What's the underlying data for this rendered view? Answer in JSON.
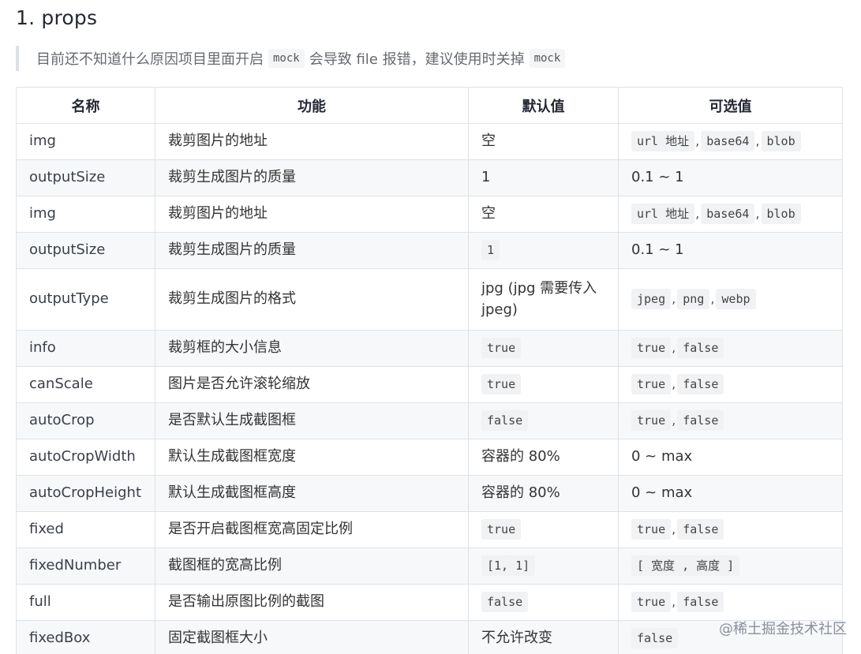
{
  "heading": "1. props",
  "note": {
    "before": "目前还不知道什么原因项目里面开启",
    "code1": "mock",
    "middle": "会导致 file 报错，建议使用时关掉",
    "code2": "mock"
  },
  "table": {
    "headers": [
      "名称",
      "功能",
      "默认值",
      "可选值"
    ],
    "rows": [
      {
        "name": "img",
        "desc": "裁剪图片的地址",
        "default": {
          "text": "空"
        },
        "options": {
          "chips": [
            "url 地址",
            "base64",
            "blob"
          ]
        }
      },
      {
        "name": "outputSize",
        "desc": "裁剪生成图片的质量",
        "default": {
          "text": "1"
        },
        "options": {
          "text": "0.1 ~ 1"
        }
      },
      {
        "name": "img",
        "desc": "裁剪图片的地址",
        "default": {
          "text": "空"
        },
        "options": {
          "chips": [
            "url 地址",
            "base64",
            "blob"
          ]
        }
      },
      {
        "name": "outputSize",
        "desc": "裁剪生成图片的质量",
        "default": {
          "chip": "1"
        },
        "options": {
          "text": "0.1 ~ 1"
        }
      },
      {
        "name": "outputType",
        "desc": "裁剪生成图片的格式",
        "default": {
          "text": "jpg (jpg 需要传入 jpeg)"
        },
        "options": {
          "chips": [
            "jpeg",
            "png",
            "webp"
          ]
        },
        "tall": true
      },
      {
        "name": "info",
        "desc": "裁剪框的大小信息",
        "default": {
          "chip": "true"
        },
        "options": {
          "chips": [
            "true",
            "false"
          ]
        }
      },
      {
        "name": "canScale",
        "desc": "图片是否允许滚轮缩放",
        "default": {
          "chip": "true"
        },
        "options": {
          "chips": [
            "true",
            "false"
          ]
        }
      },
      {
        "name": "autoCrop",
        "desc": "是否默认生成截图框",
        "default": {
          "chip": "false"
        },
        "options": {
          "chips": [
            "true",
            "false"
          ]
        }
      },
      {
        "name": "autoCropWidth",
        "desc": "默认生成截图框宽度",
        "default": {
          "text": "容器的 80%"
        },
        "options": {
          "text": "0 ~ max"
        }
      },
      {
        "name": "autoCropHeight",
        "desc": "默认生成截图框高度",
        "default": {
          "text": "容器的 80%"
        },
        "options": {
          "text": "0 ~ max"
        }
      },
      {
        "name": "fixed",
        "desc": "是否开启截图框宽高固定比例",
        "default": {
          "chip": "true"
        },
        "options": {
          "chips": [
            "true",
            "false"
          ]
        }
      },
      {
        "name": "fixedNumber",
        "desc": "截图框的宽高比例",
        "default": {
          "chip": "[1, 1]"
        },
        "options": {
          "chip": "[ 宽度 , 高度 ]"
        }
      },
      {
        "name": "full",
        "desc": "是否输出原图比例的截图",
        "default": {
          "chip": "false"
        },
        "options": {
          "chips": [
            "true",
            "false"
          ]
        }
      },
      {
        "name": "fixedBox",
        "desc": "固定截图框大小",
        "default": {
          "text": "不允许改变"
        },
        "options": {
          "chip": "false"
        }
      }
    ]
  },
  "watermark": "@稀土掘金技术社区"
}
